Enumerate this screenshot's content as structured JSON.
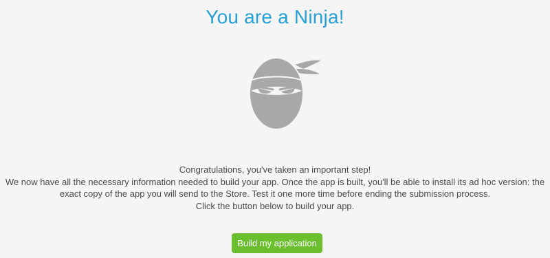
{
  "page": {
    "title": "You are a Ninja!"
  },
  "illustration": {
    "icon": "ninja-icon",
    "color": "#a8a8a8"
  },
  "message": {
    "lines": [
      "Congratulations, you've taken an important step!",
      "We now have all the necessary information needed to build your app. Once the app is built, you'll be able to install its ad hoc version: the",
      "exact copy of the app you will send to the Store. Test it one more time before ending the submission process.",
      "Click the button below to build your app."
    ]
  },
  "actions": {
    "build_label": "Build my application"
  },
  "colors": {
    "title": "#27a0d6",
    "button": "#6bbf2e",
    "background": "#f5f5f5"
  }
}
